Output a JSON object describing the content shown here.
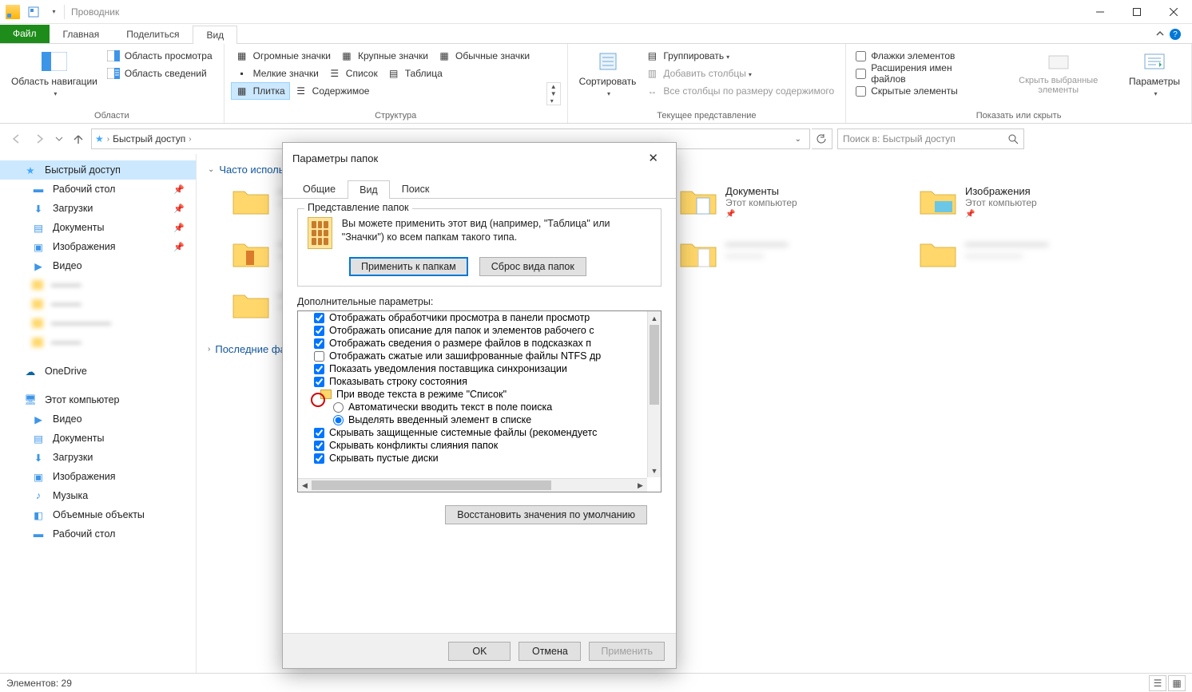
{
  "window": {
    "title": "Проводник",
    "controls": {
      "min": "—",
      "max": "▢",
      "close": "✕"
    }
  },
  "tabs": {
    "file": "Файл",
    "home": "Главная",
    "share": "Поделиться",
    "view": "Вид"
  },
  "ribbon": {
    "g_panes": {
      "label": "Области",
      "navpane": "Область навигации",
      "preview": "Область просмотра",
      "details": "Область сведений"
    },
    "g_layout": {
      "label": "Структура",
      "v_xl": "Огромные значки",
      "v_l": "Крупные значки",
      "v_m": "Обычные значки",
      "v_s": "Мелкие значки",
      "v_list": "Список",
      "v_table": "Таблица",
      "v_tiles": "Плитка",
      "v_content": "Содержимое"
    },
    "g_current": {
      "label": "Текущее представление",
      "sort": "Сортировать",
      "group": "Группировать",
      "addcols": "Добавить столбцы",
      "autosize": "Все столбцы по размеру содержимого"
    },
    "g_showhide": {
      "label": "Показать или скрыть",
      "chk_boxes": "Флажки элементов",
      "chk_ext": "Расширения имен файлов",
      "chk_hidden": "Скрытые элементы",
      "hide_sel": "Скрыть выбранные элементы",
      "options": "Параметры"
    }
  },
  "addr": {
    "crumb1": "Быстрый доступ",
    "search_placeholder": "Поиск в: Быстрый доступ"
  },
  "sidebar": {
    "quick": "Быстрый доступ",
    "desktop": "Рабочий стол",
    "downloads": "Загрузки",
    "documents": "Документы",
    "pictures": "Изображения",
    "videos": "Видео",
    "onedrive": "OneDrive",
    "thispc": "Этот компьютер",
    "pc_videos": "Видео",
    "pc_documents": "Документы",
    "pc_downloads": "Загрузки",
    "pc_pictures": "Изображения",
    "pc_music": "Музыка",
    "pc_3d": "Объемные объекты",
    "pc_desktop": "Рабочий стол"
  },
  "content": {
    "section_frequent": "Часто используемые папки",
    "section_recent": "Последние файлы",
    "documents": {
      "name": "Документы",
      "sub": "Этот компьютер"
    },
    "pictures": {
      "name": "Изображения",
      "sub": "Этот компьютер"
    }
  },
  "statusbar": {
    "count_label": "Элементов: 29"
  },
  "dialog": {
    "title": "Параметры папок",
    "tabs": {
      "general": "Общие",
      "view": "Вид",
      "search": "Поиск"
    },
    "folderview_group": "Представление папок",
    "folderview_desc": "Вы можете применить этот вид (например, \"Таблица\" или \"Значки\") ко всем папкам такого типа.",
    "apply_folders": "Применить к папкам",
    "reset_folders": "Сброс вида папок",
    "advanced_label": "Дополнительные параметры:",
    "tree": {
      "i1": "Отображать обработчики просмотра в панели просмотр",
      "i2": "Отображать описание для папок и элементов рабочего с",
      "i3": "Отображать сведения о размере файлов в подсказках п",
      "i4": "Отображать сжатые или зашифрованные файлы NTFS др",
      "i5": "Показать уведомления поставщика синхронизации",
      "i6": "Показывать строку состояния",
      "grp": "При вводе текста в режиме \"Список\"",
      "r1": "Автоматически вводить текст в поле поиска",
      "r2": "Выделять введенный элемент в списке",
      "i7": "Скрывать защищенные системные файлы (рекомендуетс",
      "i8": "Скрывать конфликты слияния папок",
      "i9": "Скрывать пустые диски"
    },
    "restore": "Восстановить значения по умолчанию",
    "ok": "OK",
    "cancel": "Отмена",
    "apply": "Применить"
  }
}
